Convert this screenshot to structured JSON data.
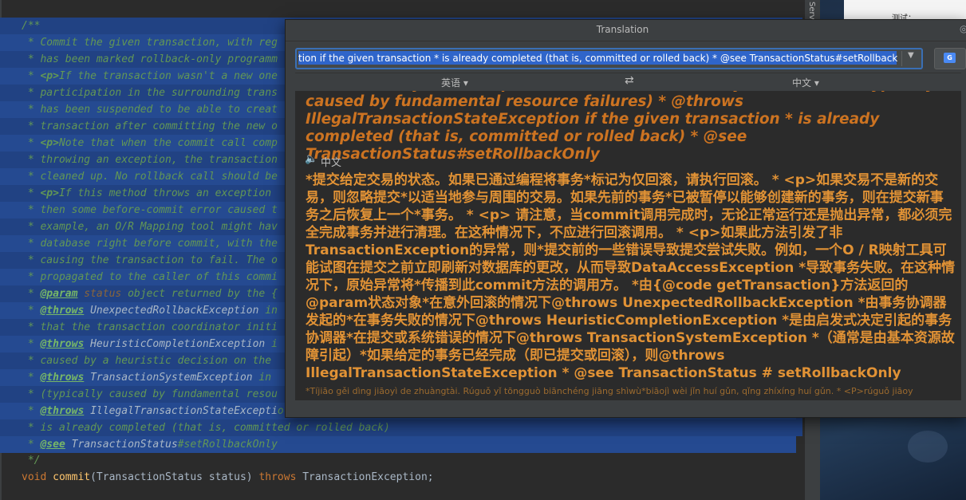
{
  "editor": {
    "lines": [
      [
        "/**"
      ],
      [
        " * Commit the given transaction, with reg"
      ],
      [
        " * has been marked rollback-only programm"
      ],
      [
        " * ",
        {
          "t": "<p>",
          "c": "kw"
        },
        "If the transaction wasn't a new one"
      ],
      [
        " * participation in the surrounding trans"
      ],
      [
        " * has been suspended to be able to creat"
      ],
      [
        " * transaction after committing the new o"
      ],
      [
        " * ",
        {
          "t": "<p>",
          "c": "kw"
        },
        "Note that when the commit call comp"
      ],
      [
        " * throwing an exception, the transaction"
      ],
      [
        " * cleaned up. No rollback call should be"
      ],
      [
        " * ",
        {
          "t": "<p>",
          "c": "kw"
        },
        "If this method throws an exception "
      ],
      [
        " * then some before-commit error caused t"
      ],
      [
        " * example, an O/R Mapping tool might hav"
      ],
      [
        " * database right before commit, with the"
      ],
      [
        " * causing the transaction to fail. The o"
      ],
      [
        " * propagated to the caller of this commi"
      ],
      [
        " * ",
        {
          "t": "@param",
          "c": "tag"
        },
        " ",
        {
          "t": "status",
          "c": "ref"
        },
        " object returned by the {"
      ],
      [
        " * ",
        {
          "t": "@throws",
          "c": "tag"
        },
        " ",
        {
          "t": "UnexpectedRollbackException",
          "c": "cls"
        },
        " in"
      ],
      [
        " * that the transaction coordinator initi"
      ],
      [
        " * ",
        {
          "t": "@throws",
          "c": "tag"
        },
        " ",
        {
          "t": "HeuristicCompletionException",
          "c": "cls"
        },
        " i"
      ],
      [
        " * caused by a heuristic decision on the "
      ],
      [
        " * ",
        {
          "t": "@throws",
          "c": "tag"
        },
        " ",
        {
          "t": "TransactionSystemException",
          "c": "cls"
        },
        " in "
      ],
      [
        " * (typically caused by fundamental resou"
      ],
      [
        " * ",
        {
          "t": "@throws",
          "c": "tag"
        },
        " ",
        {
          "t": "IllegalTransactionStateExcepti",
          "c": "cls"
        },
        "o"
      ],
      [
        " * is already completed (that is, committed or rolled back)"
      ],
      [
        " * ",
        {
          "t": "@see",
          "c": "tag"
        },
        " ",
        {
          "t": "TransactionStatus",
          "c": "cls"
        },
        "#setRollbackOnly"
      ]
    ],
    "end_comment": " */",
    "signature": {
      "kw_void": "void",
      "method": "commit",
      "params": "(TransactionStatus status) ",
      "kw_throws": "throws",
      "rest": " TransactionException;"
    }
  },
  "side_panel": {
    "label": "Serv",
    "card_text": "测试："
  },
  "translation": {
    "title": "Translation",
    "input_value": "tion if the given transaction * is already completed (that is, committed or rolled back) * @see TransactionStatus#setRollbackOnly",
    "source_lang": "英语 ▾",
    "target_lang": "中文 ▾",
    "source_text": "TransactionSystemException in case of commit or system errors * (typically caused by fundamental resource failures) * @throws IllegalTransactionStateException if the given transaction * is already completed (that is, committed or rolled back) * @see TransactionStatus#setRollbackOnly",
    "result_label": "中文",
    "result_text": "*提交给定交易的状态。如果已通过编程将事务*标记为仅回滚，请执行回滚。 * <p>如果交易不是新的交易，则忽略提交*以适当地参与周围的交易。如果先前的事务*已被暂停以能够创建新的事务，则在提交新事务之后恢复上一个*事务。 * <p> 请注意，当commit调用完成时，无论正常运行还是抛出异常，都必须完全完成事务并进行清理。在这种情况下，不应进行回滚调用。 * <p>如果此方法引发了非TransactionException的异常，则*提交前的一些错误导致提交尝试失败。例如，一个O / R映射工具可能试图在提交之前立即刷新对数据库的更改，从而导致DataAccessException *导致事务失败。在这种情况下，原始异常将*传播到此commit方法的调用方。 *由{@code getTransaction}方法返回的@param状态对象*在意外回滚的情况下@throws UnexpectedRollbackException *由事务协调器发起的*在事务失败的情况下@throws HeuristicCompletionException *是由启发式决定引起的事务协调器*在提交或系统错误的情况下@throws TransactionSystemException *（通常是由基本资源故障引起）*如果给定的事务已经完成（即已提交或回滚），则@throws IllegalTransactionStateException * @see TransactionStatus # setRollbackOnly",
    "pinyin_text": "*Tíjiāo gěi dìng jiāoyì de zhuàngtài. Rúguǒ yǐ tōngguò biānchéng jiāng shìwù*biāojì wèi jǐn huí gǔn, qǐng zhíxíng huí gǔn. * <P>rúguǒ jiāoy"
  }
}
